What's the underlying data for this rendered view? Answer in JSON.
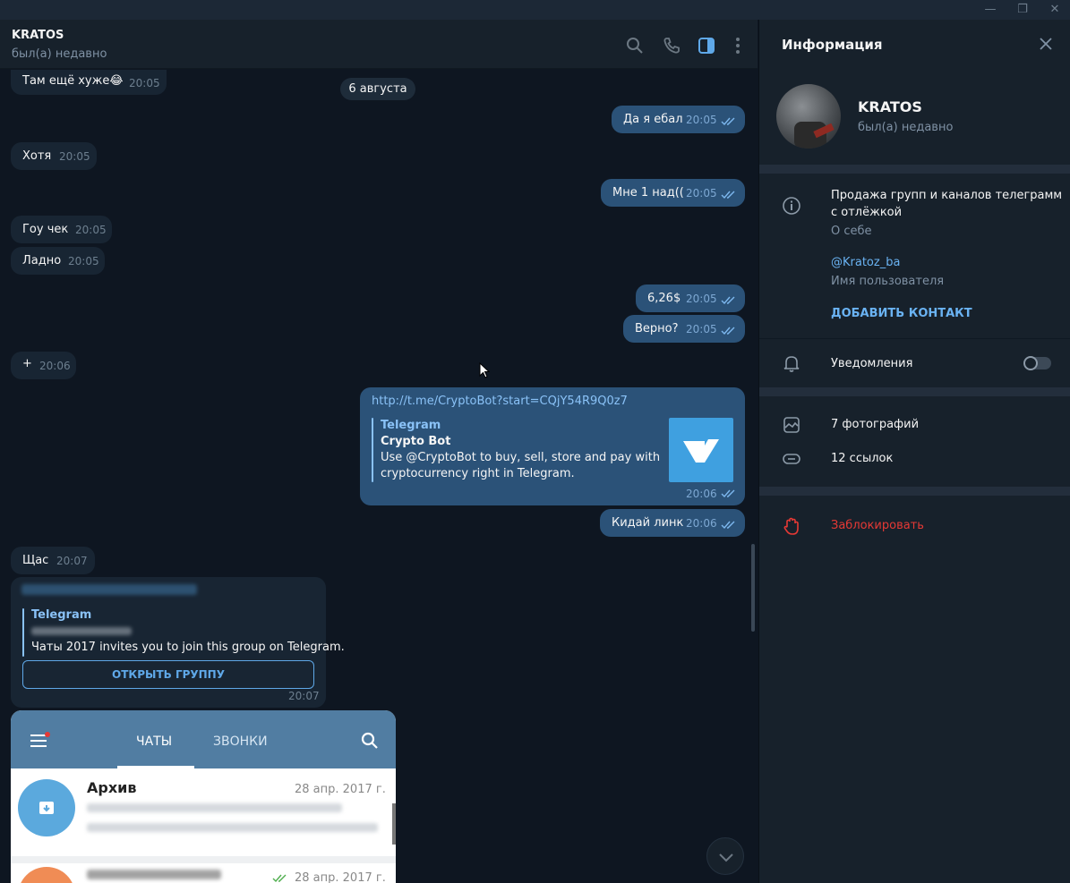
{
  "header": {
    "name": "KRATOS",
    "status": "был(а) недавно"
  },
  "date_divider": "6 августа",
  "messages": [
    {
      "text": "Там ещё хуже😂",
      "time": "20:05"
    },
    {
      "text": "Да я ебал",
      "time": "20:05"
    },
    {
      "text": "Хотя",
      "time": "20:05"
    },
    {
      "text": "Мне 1 над((",
      "time": "20:05"
    },
    {
      "text": "Гоу чек",
      "time": "20:05"
    },
    {
      "text": "Ладно",
      "time": "20:05"
    },
    {
      "text": "6,26$",
      "time": "20:05"
    },
    {
      "text": "Верно?",
      "time": "20:05"
    },
    {
      "text": "+",
      "time": "20:06"
    },
    {
      "text": "Кидай линк",
      "time": "20:06"
    },
    {
      "text": "Щас",
      "time": "20:07"
    }
  ],
  "link_message": {
    "url": "http://t.me/CryptoBot?start=CQjY54R9Q0z7",
    "site": "Telegram",
    "title": "Crypto Bot",
    "description_line1": "Use @CryptoBot to buy, sell, store and pay with",
    "description_line2": "cryptocurrency right in Telegram.",
    "time": "20:06"
  },
  "invite_message": {
    "site": "Telegram",
    "description": "Чаты 2017 invites you to join this group on Telegram.",
    "button": "ОТКРЫТЬ ГРУППУ",
    "time": "20:07"
  },
  "screenshot": {
    "tab_chats": "ЧАТЫ",
    "tab_calls": "ЗВОНКИ",
    "archive": "Архив",
    "archive_date": "28 апр. 2017 г.",
    "second_date": "28 апр. 2017 г."
  },
  "info_panel": {
    "title": "Информация",
    "name": "KRATOS",
    "status": "был(а) недавно",
    "bio_line1": "Продажа групп и каналов телеграмм",
    "bio_line2": "с отлёжкой",
    "bio_label": "О себе",
    "username": "@Kratoz_ba",
    "username_label": "Имя пользователя",
    "add_contact": "ДОБАВИТЬ КОНТАКТ",
    "notifications": "Уведомления",
    "photos": "7 фотографий",
    "links": "12 ссылок",
    "block": "Заблокировать"
  },
  "colors": {
    "accent": "#6ab3f3",
    "outgoing": "#2b5278",
    "incoming": "#182533",
    "danger": "#e53935",
    "background": "#0e1621"
  }
}
